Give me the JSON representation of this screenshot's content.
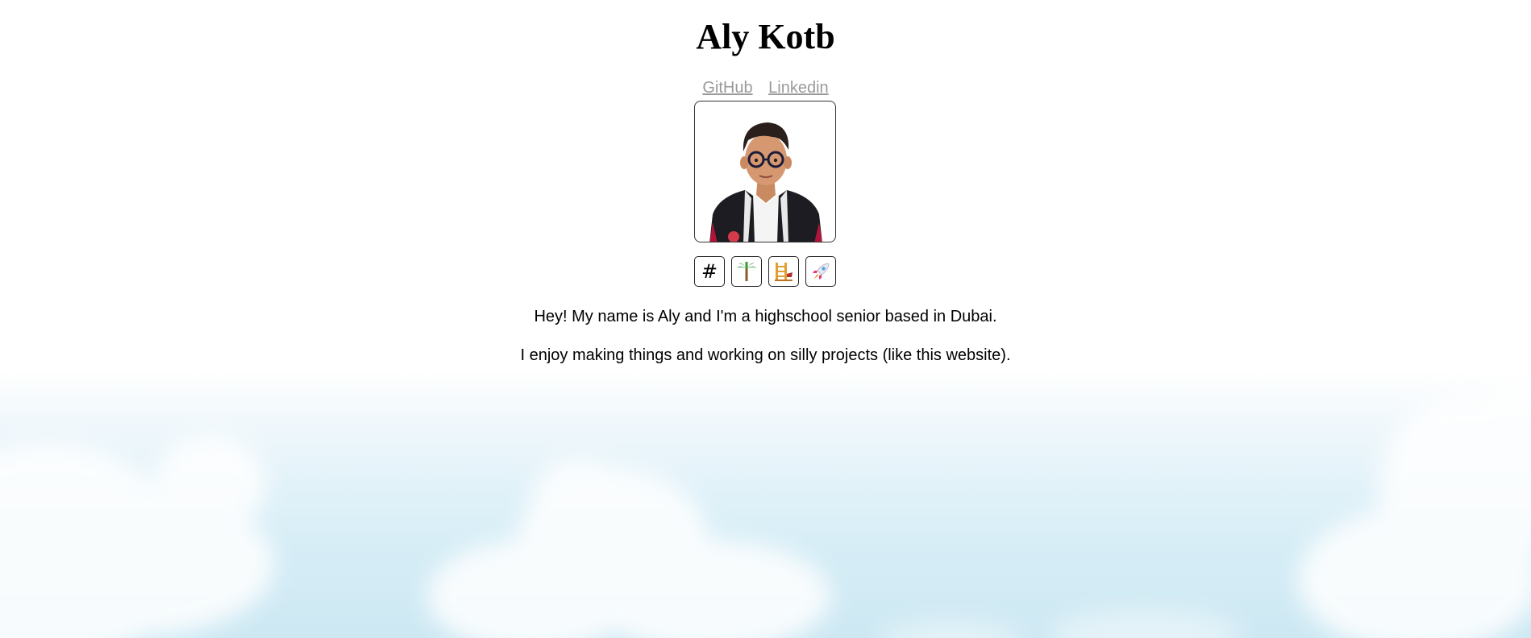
{
  "header": {
    "name": "Aly Kotb",
    "links": [
      {
        "label": "GitHub"
      },
      {
        "label": "Linkedin"
      }
    ]
  },
  "profile": {
    "photo_icon": "profile-photo"
  },
  "icons": [
    {
      "name": "hash-icon",
      "glyph": "#"
    },
    {
      "name": "palm-tree-icon"
    },
    {
      "name": "ladder-icon"
    },
    {
      "name": "rocket-icon"
    }
  ],
  "bio": {
    "line1": "Hey! My name is Aly and I'm a highschool senior based in Dubai.",
    "line2": "I enjoy making things and working on silly projects (like this website)."
  },
  "colors": {
    "link": "#9a9a9a",
    "sky_bottom": "#cde8f3",
    "border": "#333333"
  }
}
